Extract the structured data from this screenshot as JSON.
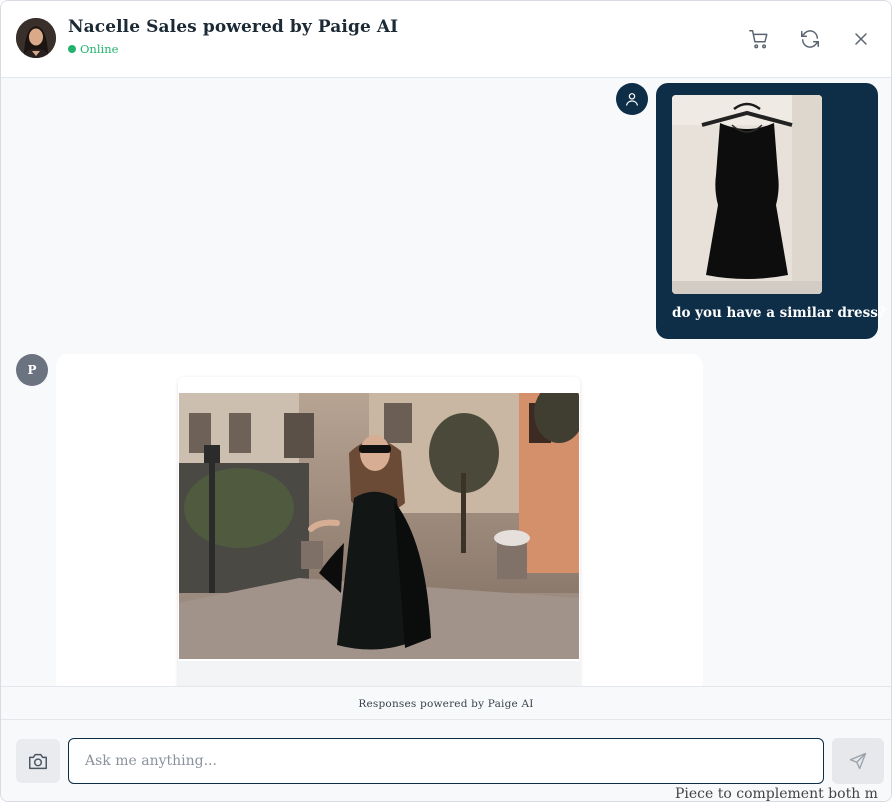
{
  "header": {
    "title": "Nacelle Sales powered by Paige AI",
    "status": "Online",
    "icons": [
      "cart-icon",
      "refresh-icon",
      "close-icon"
    ]
  },
  "messages": {
    "user": {
      "text": "do you have a similar dress?",
      "avatar_icon": "user-icon"
    },
    "bot": {
      "avatar_initial": "P"
    }
  },
  "footer": {
    "powered_text": "Responses powered by Paige AI"
  },
  "composer": {
    "placeholder": "Ask me anything...",
    "value": "",
    "camera_icon": "camera-icon",
    "send_icon": "send-icon"
  },
  "background": {
    "peek_text": "Piece to complement both m"
  },
  "colors": {
    "navy": "#0e2d47",
    "online": "#23b26d",
    "bot_avatar": "#6b7280"
  }
}
